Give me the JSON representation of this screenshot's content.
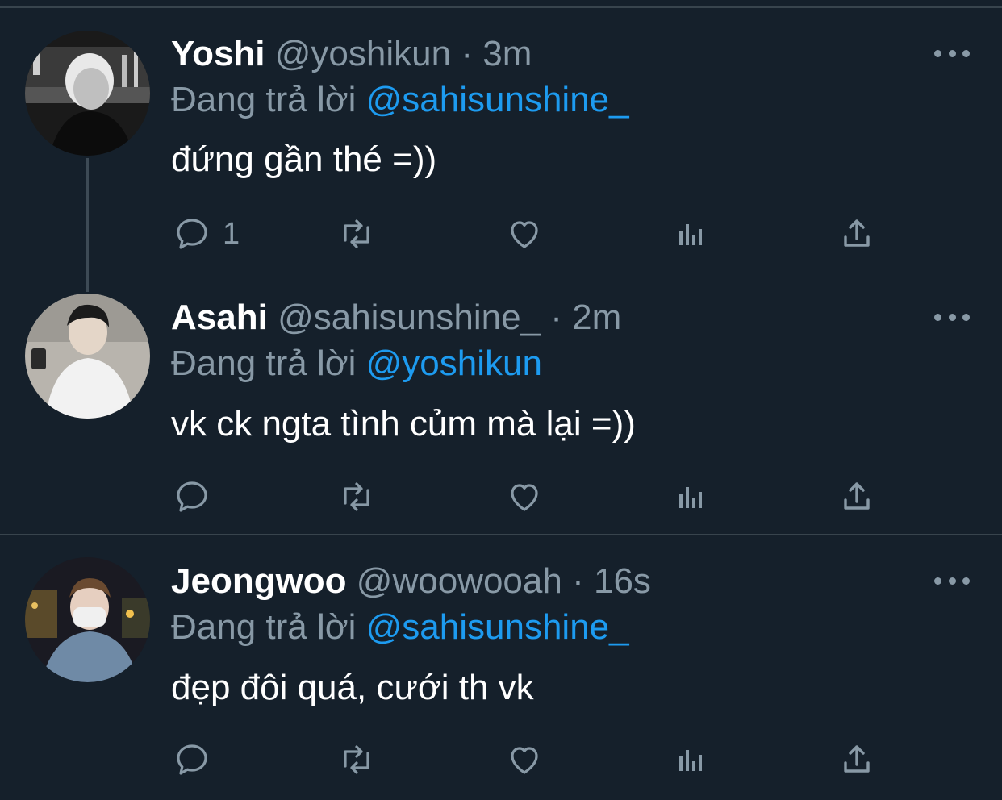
{
  "colors": {
    "background": "#15202b",
    "secondary_text": "#8899a6",
    "link": "#1d9bf0",
    "divider": "#38444d"
  },
  "tweets": [
    {
      "name": "Yoshi",
      "handle": "@yoshikun",
      "separator": "·",
      "time": "3m",
      "reply_prefix": "Đang trả lời",
      "reply_to": "@sahisunshine_",
      "text": "đứng gần thé =))",
      "reply_count": "1",
      "avatar_icon": "user-avatar-yoshi"
    },
    {
      "name": "Asahi",
      "handle": "@sahisunshine_",
      "separator": "·",
      "time": "2m",
      "reply_prefix": "Đang trả lời",
      "reply_to": "@yoshikun",
      "text": "vk ck ngta tình củm mà lại =))",
      "reply_count": "",
      "avatar_icon": "user-avatar-asahi"
    },
    {
      "name": "Jeongwoo",
      "handle": "@woowooah",
      "separator": "·",
      "time": "16s",
      "reply_prefix": "Đang trả lời",
      "reply_to": "@sahisunshine_",
      "text": "đẹp đôi quá, cưới th vk",
      "reply_count": "",
      "avatar_icon": "user-avatar-jeongwoo"
    }
  ],
  "action_icons": [
    "reply-icon",
    "retweet-icon",
    "like-icon",
    "analytics-icon",
    "share-icon"
  ]
}
